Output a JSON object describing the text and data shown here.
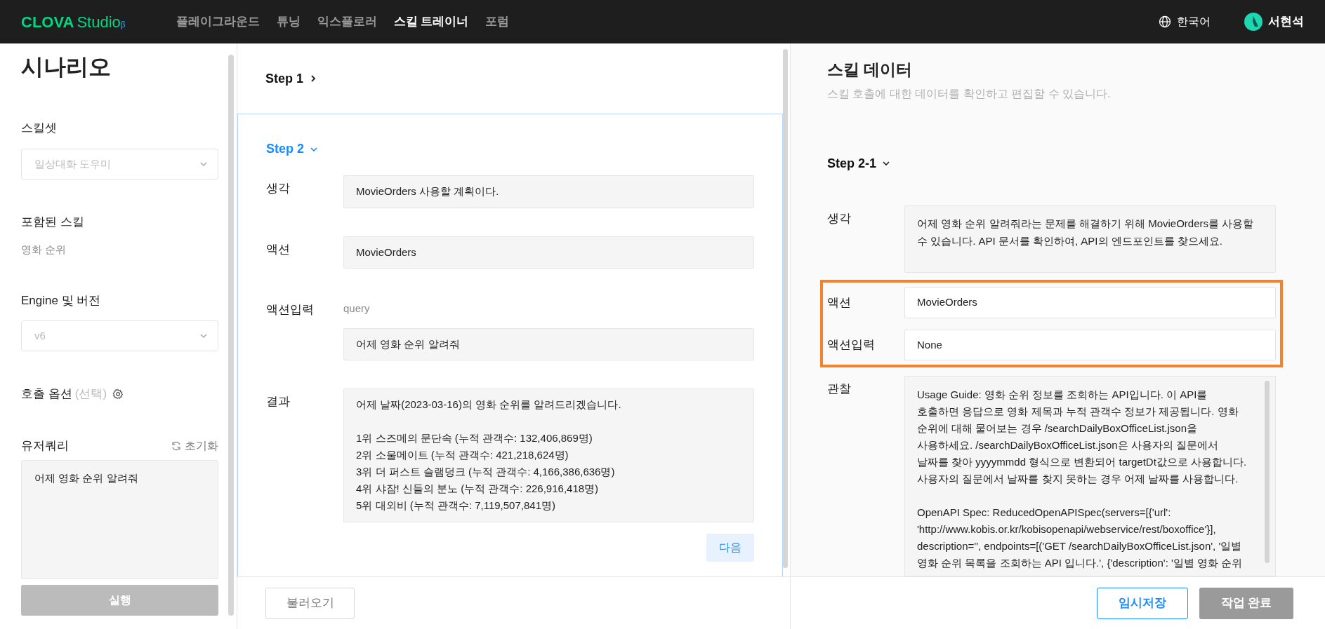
{
  "nav": {
    "logo": {
      "brand": "CLOVA",
      "product": "Studio",
      "mark": "β"
    },
    "items": [
      {
        "label": "플레이그라운드",
        "selected": false
      },
      {
        "label": "튜닝",
        "selected": false
      },
      {
        "label": "익스플로러",
        "selected": false
      },
      {
        "label": "스킬 트레이너",
        "selected": true
      },
      {
        "label": "포럼",
        "selected": false
      }
    ],
    "language": "한국어",
    "user": "서현석"
  },
  "sidebar": {
    "title": "시나리오",
    "skillset": {
      "label": "스킬셋",
      "value": "일상대화 도우미",
      "disabled": true
    },
    "included_skills": {
      "label": "포함된 스킬",
      "value": "영화 순위"
    },
    "engine": {
      "label": "Engine 및 버전",
      "value": "v6",
      "disabled": true
    },
    "call_options": {
      "label": "호출 옵션",
      "hint": "(선택)"
    },
    "user_query": {
      "label": "유저쿼리",
      "reset": "초기화",
      "value": "어제 영화 순위 알려줘"
    },
    "run_button": {
      "label": "실행",
      "disabled": true
    }
  },
  "steps": [
    {
      "title": "Step 1",
      "expanded": false
    },
    {
      "title": "Step 2",
      "expanded": true,
      "fields": [
        {
          "kind": "text",
          "label": "생각",
          "value": "MovieOrders 사용할 계획이다."
        },
        {
          "kind": "text",
          "label": "액션",
          "value": "MovieOrders"
        },
        {
          "kind": "param",
          "label": "액션입력",
          "param": "query",
          "value": "어제 영화 순위 알려줘"
        },
        {
          "kind": "lines",
          "label": "결과",
          "paragraphs": [
            [
              "어제 날짜(2023-03-16)의 영화 순위를 알려드리겠습니다."
            ],
            [
              "1위 스즈메의 문단속 (누적 관객수: 132,406,869명)",
              "2위 소울메이트 (누적 관객수: 421,218,624명)",
              "3위 더 퍼스트 슬램덩크 (누적 관객수: 4,166,386,636명)",
              "4위 샤잠! 신들의 분노 (누적 관객수: 226,916,418명)",
              "5위 대외비 (누적 관객수: 7,119,507,841명)"
            ]
          ]
        }
      ],
      "next_button": "다음"
    }
  ],
  "load_button": "불러오기",
  "skill_data": {
    "title": "스킬 데이터",
    "subtitle": "스킬 호출에 대한 데이터를 확인하고 편집할 수 있습니다.",
    "step": {
      "title": "Step 2-1",
      "expanded": true,
      "highlighted": true,
      "thought": {
        "label": "생각",
        "value": "어제 영화 순위 알려줘라는 문제를 해결하기 위해 MovieOrders를 사용할 수 있습니다. API 문서를 확인하여, API의 엔드포인트를 찾으세요."
      },
      "action": {
        "label": "액션",
        "value": "MovieOrders"
      },
      "action_input": {
        "label": "액션입력",
        "value": "None"
      },
      "observation": {
        "label": "관찰",
        "paragraphs": [
          [
            "Usage Guide: 영화 순위 정보를 조회하는 API입니다. 이 API를",
            "호출하면 응답으로 영화 제목과 누적 관객수 정보가 제공됩니다. 영화",
            "순위에 대해 물어보는 경우 /searchDailyBoxOfficeList.json을",
            "사용하세요. /searchDailyBoxOfficeList.json은 사용자의 질문에서",
            "날짜를 찾아 yyyymmdd 형식으로 변환되어 targetDt값으로 사용합니다.",
            "사용자의 질문에서 날짜를 찾지 못하는 경우 어제 날짜를 사용합니다."
          ],
          [
            "OpenAPI Spec: ReducedOpenAPISpec(servers=[{'url':",
            "'http://www.kobis.or.kr/kobisopenapi/webservice/rest/boxoffice'}],",
            "description='', endpoints=[('GET /searchDailyBoxOfficeList.json', '일별",
            "영화 순위 목록을 조회하는 API 입니다.', {'description': '일별 영화 순위"
          ]
        ]
      }
    }
  },
  "footer_buttons": [
    {
      "label": "임시저장",
      "disabled": false
    },
    {
      "label": "작업 완료",
      "disabled": true
    }
  ]
}
